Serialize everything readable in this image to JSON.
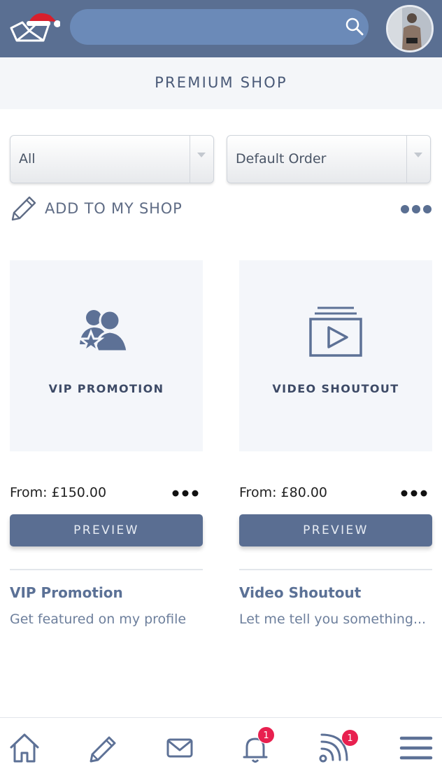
{
  "header": {
    "logo_icon": "santa-hat-crown-logo",
    "search": {
      "value": "",
      "placeholder": ""
    },
    "search_icon": "search-icon",
    "avatar_icon": "user-avatar"
  },
  "page_title": "PREMIUM SHOP",
  "filters": {
    "category": {
      "selected": "All"
    },
    "order": {
      "selected": "Default Order"
    }
  },
  "add_to_shop_label": "ADD TO MY SHOP",
  "products": [
    {
      "card_title": "VIP PROMOTION",
      "icon": "vip-users-star-icon",
      "price": "From: £150.00",
      "preview_label": "PREVIEW",
      "name": "VIP Promotion",
      "description": "Get featured on my profile"
    },
    {
      "card_title": "VIDEO SHOUTOUT",
      "icon": "video-play-icon",
      "price": "From: £80.00",
      "preview_label": "PREVIEW",
      "name": "Video Shoutout",
      "description": "Let me tell you something..."
    }
  ],
  "bottom_nav": {
    "items": [
      "home-icon",
      "pencil-icon",
      "mail-icon",
      "bell-icon",
      "feed-icon",
      "menu-icon"
    ],
    "notifications_badge": "1",
    "feed_badge": "1"
  },
  "colors": {
    "header": "#5a6f92",
    "search": "#6b8ab8",
    "button": "#5a6e92",
    "link": "#5b7196",
    "badge": "#e8204f"
  }
}
